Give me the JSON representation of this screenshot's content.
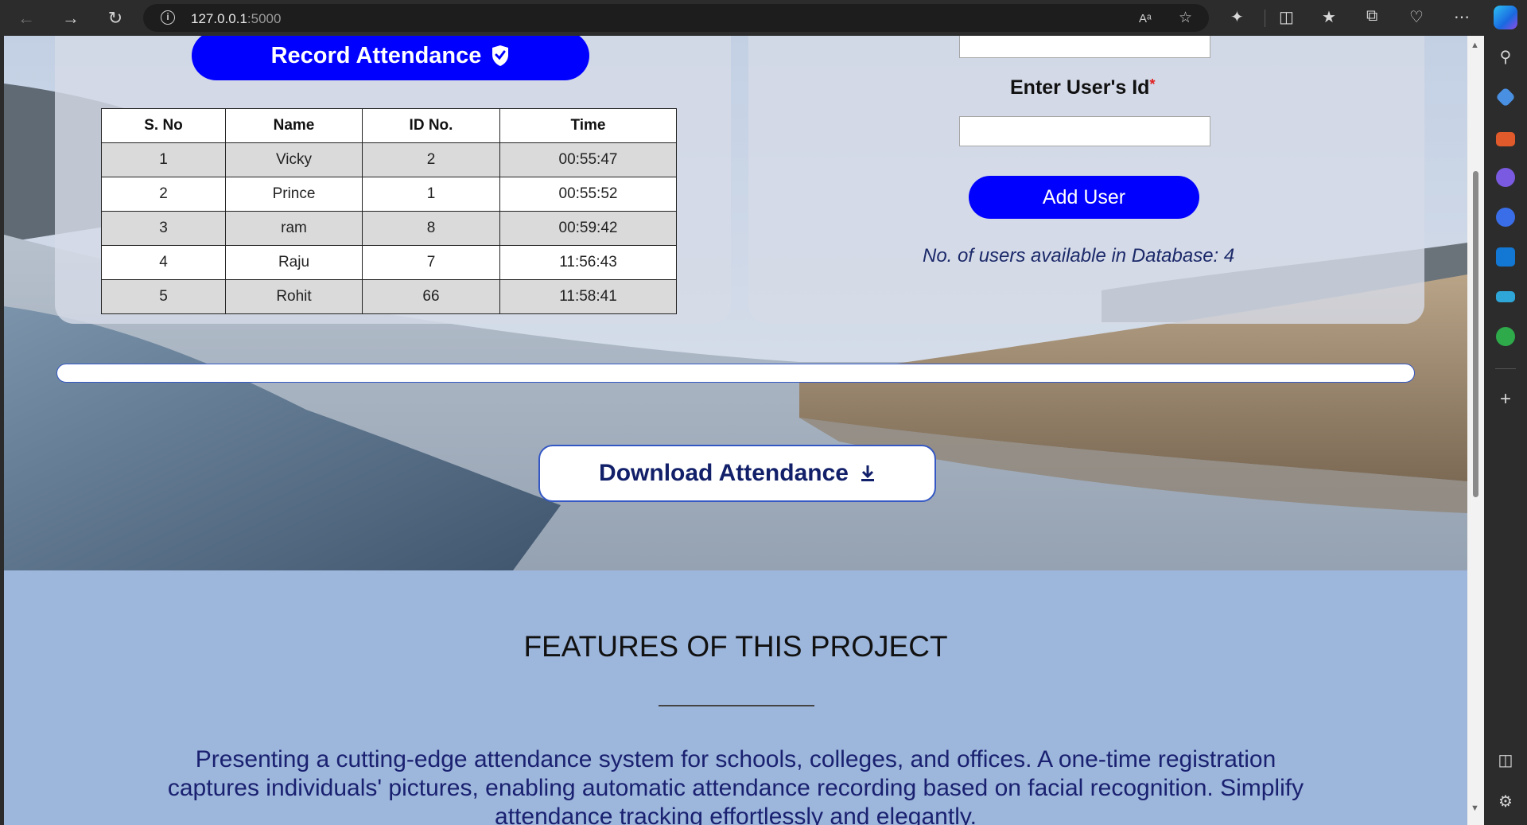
{
  "browser": {
    "url_host": "127.0.0.1",
    "url_port": ":5000",
    "read_aloud_label": "Aᵃ"
  },
  "left_panel": {
    "record_button_label": "Record Attendance",
    "table": {
      "headers": [
        "S. No",
        "Name",
        "ID No.",
        "Time"
      ],
      "rows": [
        {
          "sno": "1",
          "name": "Vicky",
          "id": "2",
          "time": "00:55:47"
        },
        {
          "sno": "2",
          "name": "Prince",
          "id": "1",
          "time": "00:55:52"
        },
        {
          "sno": "3",
          "name": "ram",
          "id": "8",
          "time": "00:59:42"
        },
        {
          "sno": "4",
          "name": "Raju",
          "id": "7",
          "time": "11:56:43"
        },
        {
          "sno": "5",
          "name": "Rohit",
          "id": "66",
          "time": "11:58:41"
        }
      ]
    }
  },
  "right_panel": {
    "name_input_value": "",
    "user_id_label": "Enter User's Id",
    "required_mark": "*",
    "user_id_value": "",
    "add_user_label": "Add User",
    "db_count_text": "No. of users available in Database: 4"
  },
  "progress": {
    "value": 0
  },
  "download_label": "Download Attendance",
  "features": {
    "title": "FEATURES OF THIS PROJECT",
    "description": "Presenting a cutting-edge attendance system for schools, colleges, and offices. A one-time registration captures individuals' pictures, enabling automatic attendance recording based on facial recognition. Simplify attendance tracking effortlessly and elegantly."
  },
  "colors": {
    "primary_button": "#0000ff",
    "accent_border": "#3457c4",
    "text_navy": "#1a2170"
  },
  "icons": {
    "record": "shield-check-icon",
    "download": "download-icon"
  }
}
